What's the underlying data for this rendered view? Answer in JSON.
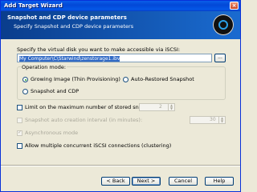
{
  "window": {
    "title": "Add Target Wizard"
  },
  "header": {
    "title": "Snapshot and CDP device parameters",
    "subtitle": "Specify Snapshot and CDP device parameters"
  },
  "path": {
    "label": "Specify the virtual disk you want to make accessible via iSCSI:",
    "value": "My Computer\\C\\Starwind\\zenstorage1.ibv",
    "browse_label": "..."
  },
  "operation_mode": {
    "title": "Operation mode:",
    "options": [
      {
        "label": "Growing Image (Thin Provisioning)",
        "selected": true
      },
      {
        "label": "Auto-Restored Snapshot",
        "selected": false
      },
      {
        "label": "Snapshot and CDP",
        "selected": false
      }
    ]
  },
  "options": {
    "limit_snapshots": {
      "label": "Limit on the maximum number of stored snapshots:",
      "checked": false,
      "enabled": true,
      "value": "2"
    },
    "auto_interval": {
      "label": "Snapshot auto creation interval (in minutes):",
      "checked": false,
      "enabled": false,
      "value": "30"
    },
    "async_mode": {
      "label": "Asynchronous mode",
      "checked": true,
      "enabled": false
    },
    "multi_conn": {
      "label": "Allow multiple concurrent iSCSI connections (clustering)",
      "checked": false,
      "enabled": true
    }
  },
  "buttons": {
    "back": "< Back",
    "next": "Next >",
    "cancel": "Cancel",
    "help": "Help"
  },
  "colors": {
    "title_bar": "#0a5ee9",
    "header_bg": "#0a3d8c",
    "dialog_bg": "#ece9d8",
    "selection": "#316ac5"
  }
}
